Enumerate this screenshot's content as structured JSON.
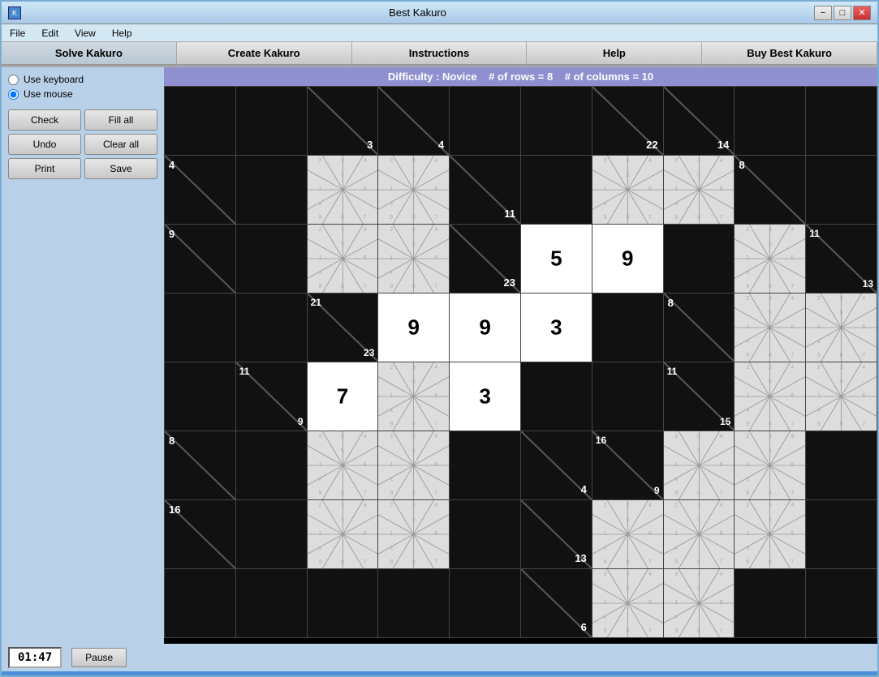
{
  "window": {
    "title": "Best Kakuro",
    "minimize_label": "−",
    "restore_label": "□",
    "close_label": "✕"
  },
  "menu": {
    "items": [
      "File",
      "Edit",
      "View",
      "Help"
    ]
  },
  "nav": {
    "buttons": [
      "Solve Kakuro",
      "Create Kakuro",
      "Instructions",
      "Help",
      "Buy Best Kakuro"
    ]
  },
  "sidebar": {
    "radio1": "Use keyboard",
    "radio2": "Use mouse",
    "check_label": "Check",
    "fill_label": "Fill all",
    "undo_label": "Undo",
    "clear_label": "Clear all",
    "print_label": "Print",
    "save_label": "Save"
  },
  "status": {
    "difficulty": "Difficulty : Novice",
    "rows": "# of rows = 8",
    "columns": "# of columns = 10"
  },
  "timer": {
    "value": "01:47",
    "pause_label": "Pause"
  },
  "colors": {
    "accent": "#9090d0",
    "bg": "#4a90d9"
  }
}
